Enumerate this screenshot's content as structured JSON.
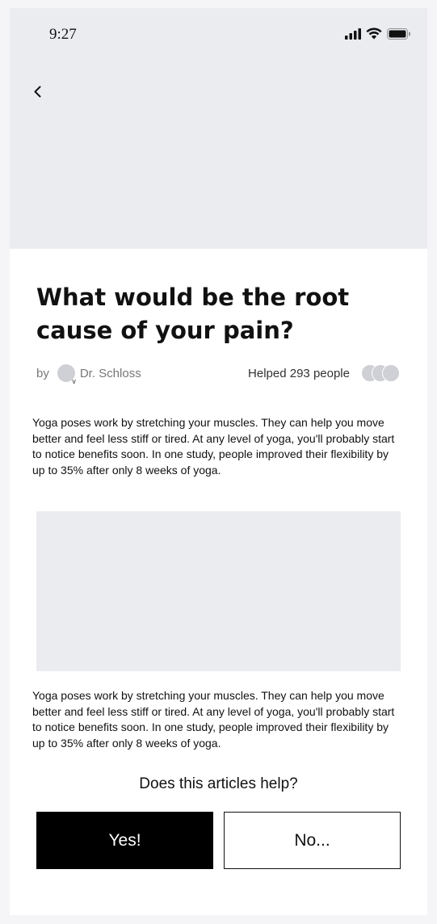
{
  "status_bar": {
    "time": "9:27",
    "icons": [
      "signal-icon",
      "wifi-icon",
      "battery-icon"
    ]
  },
  "header": {
    "back_icon": "chevron-left-icon"
  },
  "article": {
    "title": "What would be the root cause of your pain?",
    "by_label": "by",
    "author_name": "Dr. Schloss",
    "author_avatar_badge": "v",
    "helped_text": "Helped 293 people",
    "paragraph_1": "Yoga poses work by stretching your muscles. They can help you move better and feel less stiff or tired. At any level of yoga, you'll probably start to notice benefits soon. In one study, people improved their flexibility by up to 35% after only 8 weeks of yoga.",
    "paragraph_2": "Yoga poses work by stretching your muscles. They can help you move better and feel less stiff or tired. At any level of yoga, you'll probably start to notice benefits soon. In one study, people improved their flexibility by up to 35% after only 8 weeks of yoga."
  },
  "feedback": {
    "question": "Does this articles help?",
    "yes_label": "Yes!",
    "no_label": "No..."
  },
  "colors": {
    "placeholder_gray": "#ebecf0",
    "primary_button": "#000000",
    "text": "#111111"
  }
}
